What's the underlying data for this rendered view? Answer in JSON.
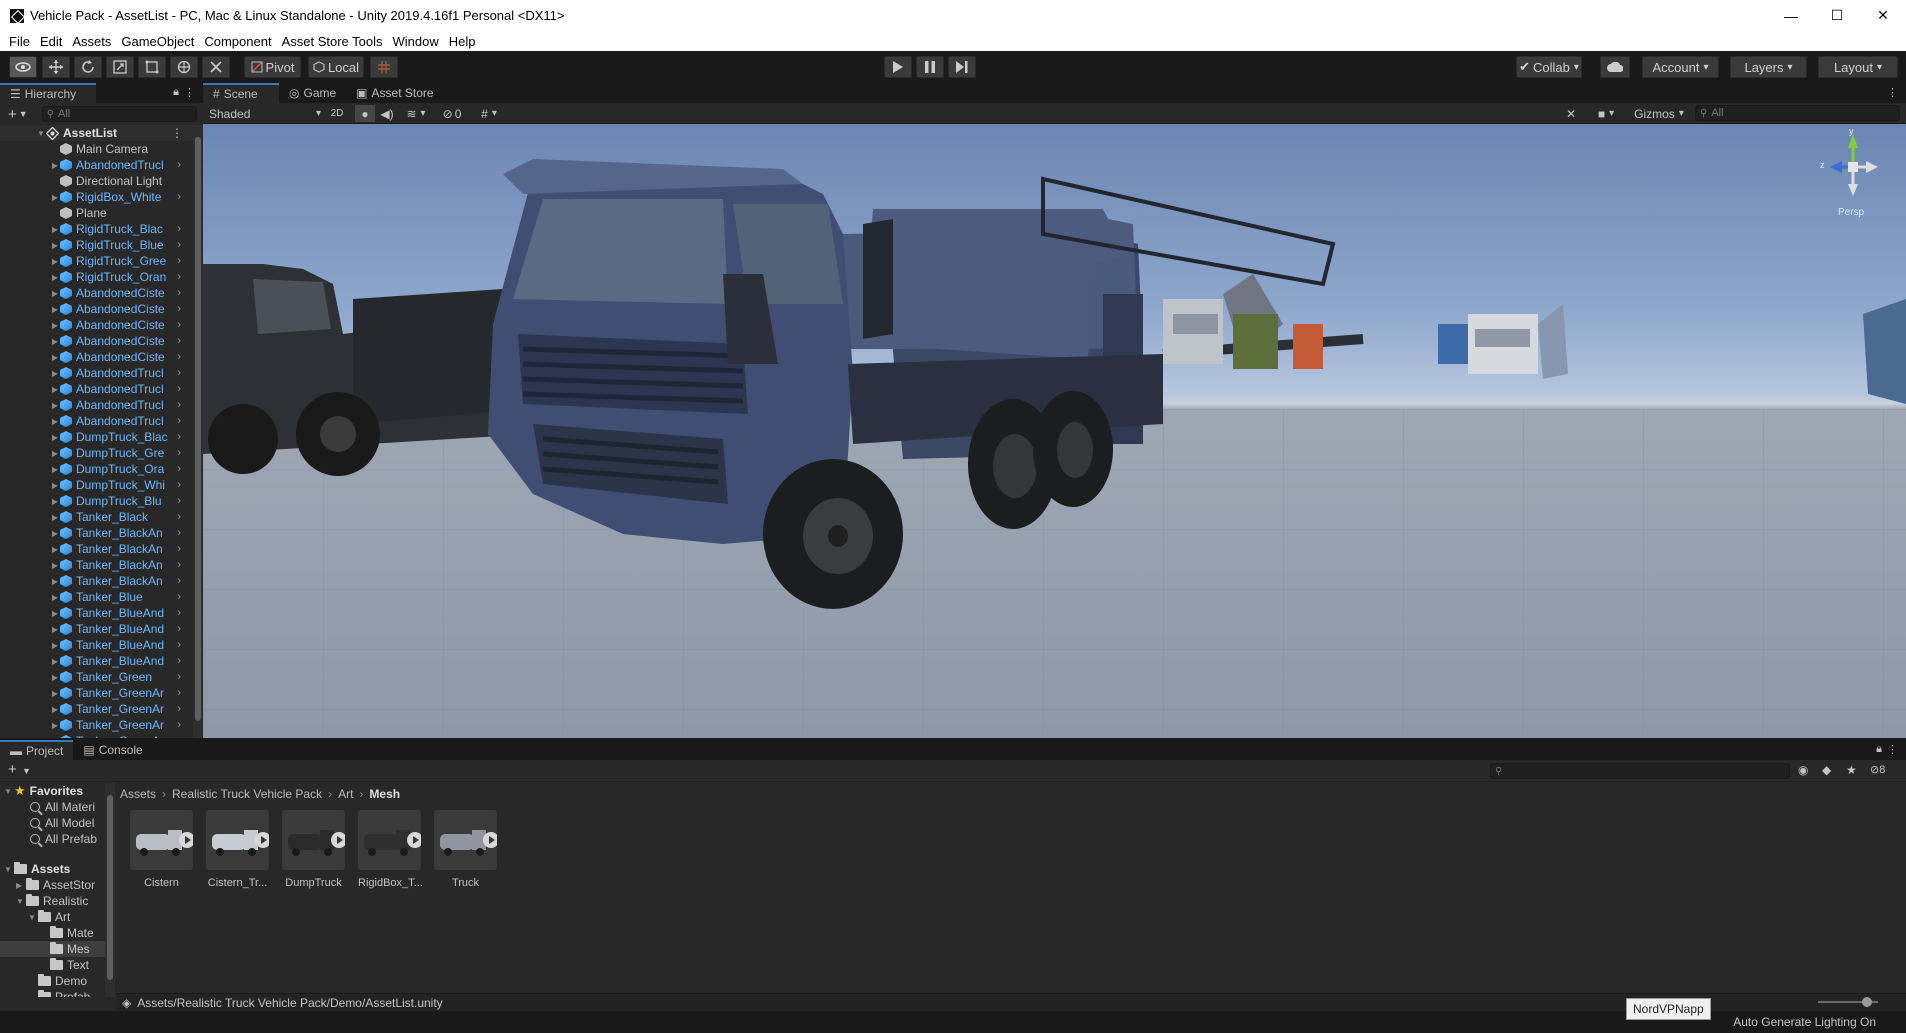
{
  "window": {
    "title": "Vehicle Pack - AssetList - PC, Mac & Linux Standalone - Unity 2019.4.16f1 Personal <DX11>",
    "buttons": {
      "minimize": "—",
      "maximize": "☐",
      "close": "✕"
    }
  },
  "menu": [
    "File",
    "Edit",
    "Assets",
    "GameObject",
    "Component",
    "Asset Store Tools",
    "Window",
    "Help"
  ],
  "toolbar": {
    "pivot": "Pivot",
    "local": "Local",
    "collab": "Collab",
    "account": "Account",
    "layers": "Layers",
    "layout": "Layout"
  },
  "hierarchy": {
    "tab": "Hierarchy",
    "search_placeholder": "All",
    "root": "AssetList",
    "items": [
      {
        "label": "Main Camera",
        "prefab": false,
        "expandable": false
      },
      {
        "label": "AbandonedTrucl",
        "prefab": true,
        "expandable": true
      },
      {
        "label": "Directional Light",
        "prefab": false,
        "expandable": false
      },
      {
        "label": "RigidBox_White",
        "prefab": true,
        "expandable": true
      },
      {
        "label": "Plane",
        "prefab": false,
        "expandable": false
      },
      {
        "label": "RigidTruck_Blac",
        "prefab": true,
        "expandable": true
      },
      {
        "label": "RigidTruck_Blue",
        "prefab": true,
        "expandable": true
      },
      {
        "label": "RigidTruck_Gree",
        "prefab": true,
        "expandable": true
      },
      {
        "label": "RigidTruck_Oran",
        "prefab": true,
        "expandable": true
      },
      {
        "label": "AbandonedCiste",
        "prefab": true,
        "expandable": true
      },
      {
        "label": "AbandonedCiste",
        "prefab": true,
        "expandable": true
      },
      {
        "label": "AbandonedCiste",
        "prefab": true,
        "expandable": true
      },
      {
        "label": "AbandonedCiste",
        "prefab": true,
        "expandable": true
      },
      {
        "label": "AbandonedCiste",
        "prefab": true,
        "expandable": true
      },
      {
        "label": "AbandonedTrucl",
        "prefab": true,
        "expandable": true
      },
      {
        "label": "AbandonedTrucl",
        "prefab": true,
        "expandable": true
      },
      {
        "label": "AbandonedTrucl",
        "prefab": true,
        "expandable": true
      },
      {
        "label": "AbandonedTrucl",
        "prefab": true,
        "expandable": true
      },
      {
        "label": "DumpTruck_Blac",
        "prefab": true,
        "expandable": true
      },
      {
        "label": "DumpTruck_Gre",
        "prefab": true,
        "expandable": true
      },
      {
        "label": "DumpTruck_Ora",
        "prefab": true,
        "expandable": true
      },
      {
        "label": "DumpTruck_Whi",
        "prefab": true,
        "expandable": true
      },
      {
        "label": "DumpTruck_Blu",
        "prefab": true,
        "expandable": true
      },
      {
        "label": "Tanker_Black",
        "prefab": true,
        "expandable": true
      },
      {
        "label": "Tanker_BlackAn",
        "prefab": true,
        "expandable": true
      },
      {
        "label": "Tanker_BlackAn",
        "prefab": true,
        "expandable": true
      },
      {
        "label": "Tanker_BlackAn",
        "prefab": true,
        "expandable": true
      },
      {
        "label": "Tanker_BlackAn",
        "prefab": true,
        "expandable": true
      },
      {
        "label": "Tanker_Blue",
        "prefab": true,
        "expandable": true
      },
      {
        "label": "Tanker_BlueAnd",
        "prefab": true,
        "expandable": true
      },
      {
        "label": "Tanker_BlueAnd",
        "prefab": true,
        "expandable": true
      },
      {
        "label": "Tanker_BlueAnd",
        "prefab": true,
        "expandable": true
      },
      {
        "label": "Tanker_BlueAnd",
        "prefab": true,
        "expandable": true
      },
      {
        "label": "Tanker_Green",
        "prefab": true,
        "expandable": true
      },
      {
        "label": "Tanker_GreenAr",
        "prefab": true,
        "expandable": true
      },
      {
        "label": "Tanker_GreenAr",
        "prefab": true,
        "expandable": true
      },
      {
        "label": "Tanker_GreenAr",
        "prefab": true,
        "expandable": true
      },
      {
        "label": "Tanker_GreenAr",
        "prefab": true,
        "expandable": true
      }
    ]
  },
  "scene": {
    "tabs": [
      "Scene",
      "Game",
      "Asset Store"
    ],
    "shading": "Shaded",
    "mode_2d": "2D",
    "hidden_count": "0",
    "gizmos": "Gizmos",
    "search_placeholder": "All",
    "gizmo": {
      "y": "y",
      "z": "z",
      "projection": "Persp"
    }
  },
  "project": {
    "tabs": [
      "Project",
      "Console"
    ],
    "hidden_count": "8",
    "favorites": {
      "label": "Favorites",
      "items": [
        "All Materi",
        "All Model",
        "All Prefab"
      ]
    },
    "assets_tree": [
      {
        "label": "Assets",
        "depth": 0,
        "bold": true,
        "open": true
      },
      {
        "label": "AssetStor",
        "depth": 1,
        "bold": false,
        "open": false
      },
      {
        "label": "Realistic",
        "depth": 1,
        "bold": false,
        "open": true
      },
      {
        "label": "Art",
        "depth": 2,
        "bold": false,
        "open": true
      },
      {
        "label": "Mate",
        "depth": 3,
        "bold": false,
        "open": false
      },
      {
        "label": "Mes",
        "depth": 3,
        "bold": false,
        "open": false,
        "selected": true
      },
      {
        "label": "Text",
        "depth": 3,
        "bold": false,
        "open": false
      },
      {
        "label": "Demo",
        "depth": 2,
        "bold": false,
        "open": false
      },
      {
        "label": "Prefab",
        "depth": 2,
        "bold": false,
        "open": false
      }
    ],
    "breadcrumb": [
      "Assets",
      "Realistic Truck Vehicle Pack",
      "Art",
      "Mesh"
    ],
    "assets": [
      {
        "name": "Cistern",
        "color": "#b8bec6"
      },
      {
        "name": "Cistern_Tr...",
        "color": "#c6ccd4"
      },
      {
        "name": "DumpTruck",
        "color": "#2b2b2b"
      },
      {
        "name": "RigidBox_T...",
        "color": "#2f2f2f"
      },
      {
        "name": "Truck",
        "color": "#8f96a0"
      }
    ],
    "path": "Assets/Realistic Truck Vehicle Pack/Demo/AssetList.unity"
  },
  "statusbar": {
    "tooltip": "NordVPNapp",
    "message": "Auto Generate Lighting On"
  }
}
